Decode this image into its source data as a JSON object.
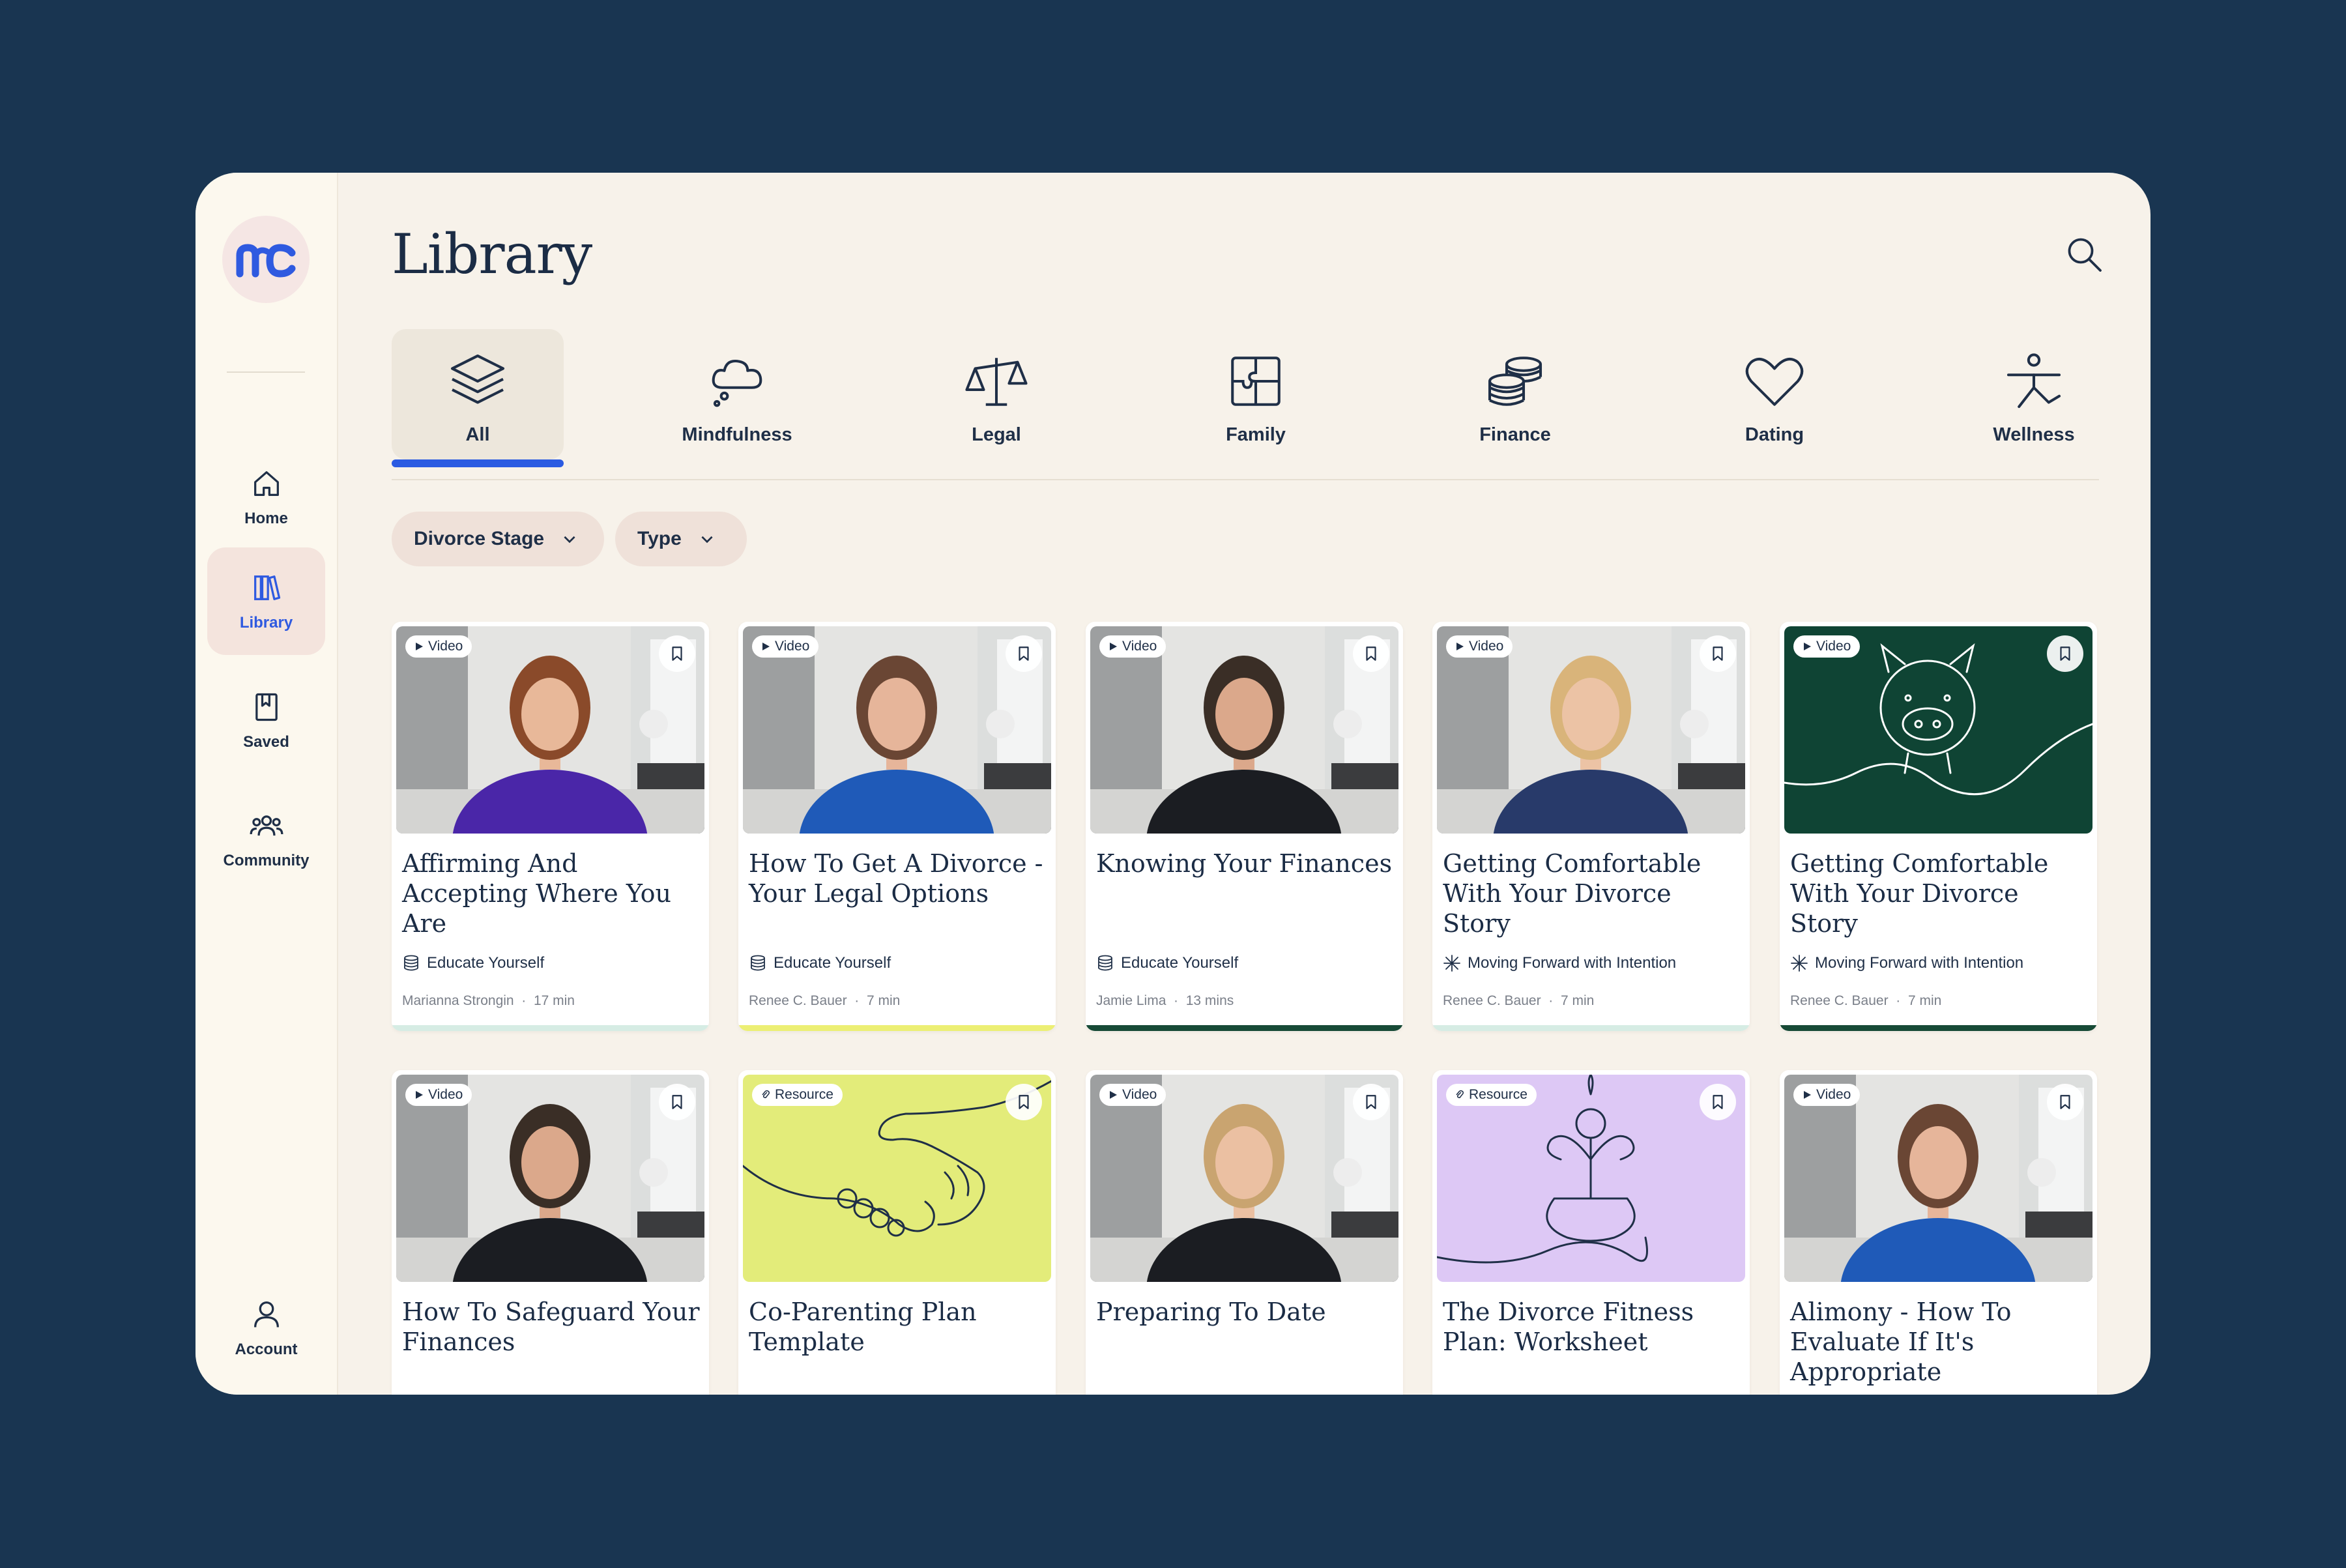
{
  "page": {
    "title": "Library"
  },
  "sidebar": {
    "items": [
      {
        "label": "Home",
        "icon": "home-icon"
      },
      {
        "label": "Library",
        "icon": "library-icon",
        "active": true
      },
      {
        "label": "Saved",
        "icon": "saved-icon"
      },
      {
        "label": "Community",
        "icon": "community-icon"
      }
    ],
    "account_label": "Account"
  },
  "categories": [
    {
      "label": "All",
      "icon": "layers-icon",
      "active": true
    },
    {
      "label": "Mindfulness",
      "icon": "thought-cloud-icon"
    },
    {
      "label": "Legal",
      "icon": "scales-icon"
    },
    {
      "label": "Family",
      "icon": "puzzle-icon"
    },
    {
      "label": "Finance",
      "icon": "coins-icon"
    },
    {
      "label": "Dating",
      "icon": "heart-icon"
    },
    {
      "label": "Wellness",
      "icon": "person-stretch-icon"
    }
  ],
  "filters": [
    {
      "label": "Divorce Stage"
    },
    {
      "label": "Type"
    }
  ],
  "colors": {
    "background": "#193551",
    "panel": "#f7f2ea",
    "sidebar": "#fcf8ee",
    "accent_blue": "#2b5be2",
    "active_pill": "#f4e4dd",
    "dark_green": "#0f4434",
    "lime": "#e3ec7a",
    "lavender": "#ddc8f5",
    "bar_mint": "#d6ece4",
    "bar_yellow": "#ecef74",
    "bar_green": "#174a36"
  },
  "cards": [
    {
      "badge": "Video",
      "title": "Affirming And Accepting Where You Are",
      "category": "Educate Yourself",
      "category_icon": "stack-icon",
      "author": "Marianna Strongin",
      "duration": "17 min",
      "bar_color": "#d6ece4",
      "thumb": "person-purple"
    },
    {
      "badge": "Video",
      "title": "How To Get A Divorce - Your Legal Options",
      "category": "Educate Yourself",
      "category_icon": "stack-icon",
      "author": "Renee C. Bauer",
      "duration": "7 min",
      "bar_color": "#ecef74",
      "thumb": "person-blue"
    },
    {
      "badge": "Video",
      "title": "Knowing Your Finances",
      "category": "Educate Yourself",
      "category_icon": "stack-icon",
      "author": "Jamie Lima",
      "duration": "13 mins",
      "bar_color": "#174a36",
      "thumb": "person-black"
    },
    {
      "badge": "Video",
      "title": "Getting Comfortable With Your Divorce Story",
      "category": "Moving Forward with Intention",
      "category_icon": "sparkle-icon",
      "author": "Renee C. Bauer",
      "duration": "7 min",
      "bar_color": "#d6ece4",
      "thumb": "person-navy"
    },
    {
      "badge": "Video",
      "title": "Getting Comfortable With Your Divorce Story",
      "category": "Moving Forward with Intention",
      "category_icon": "sparkle-icon",
      "author": "Renee C. Bauer",
      "duration": "7 min",
      "bar_color": "#174a36",
      "thumb": "piggy-bank"
    },
    {
      "badge": "Video",
      "title": "How To Safeguard Your Finances",
      "thumb": "person-black"
    },
    {
      "badge": "Resource",
      "title": "Co-Parenting Plan Template",
      "thumb": "handshake"
    },
    {
      "badge": "Video",
      "title": "Preparing To Date",
      "thumb": "person-black-f"
    },
    {
      "badge": "Resource",
      "title": "The Divorce Fitness Plan: Worksheet",
      "thumb": "meditation"
    },
    {
      "badge": "Video",
      "title": "Alimony - How To Evaluate If It's Appropriate",
      "thumb": "person-blue"
    }
  ]
}
